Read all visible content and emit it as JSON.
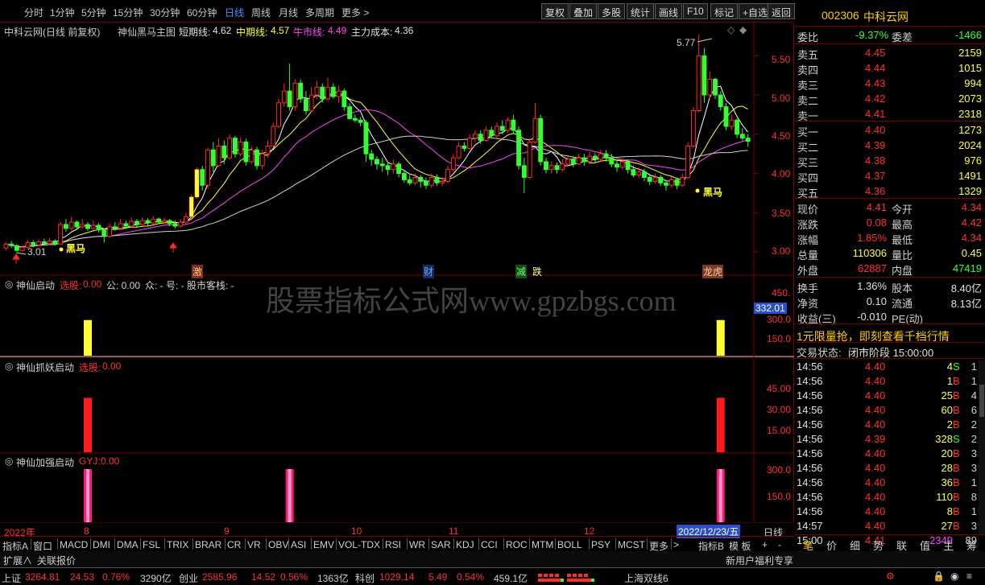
{
  "periods": [
    "分时",
    "1分钟",
    "5分钟",
    "15分钟",
    "30分钟",
    "60分钟",
    "日线",
    "周线",
    "月线",
    "多周期",
    "更多 >"
  ],
  "selected_period": "日线",
  "toolbar_buttons": [
    "复权",
    "叠加",
    "多股",
    "统计",
    "画线",
    "F10",
    "标记",
    "+自选",
    "返回"
  ],
  "header": {
    "stock_title": "中科云网(日线 前复权)",
    "indicator_name": "神仙黑马主图",
    "short_label": "短期线:",
    "short_val": "4.62",
    "mid_label": "中期线:",
    "mid_val": "4.57",
    "bull_label": "牛市线:",
    "bull_val": "4.49",
    "cost_label": "主力成本:",
    "cost_val": "4.36"
  },
  "price_axis": [
    "5.50",
    "5.00",
    "4.50",
    "4.00",
    "3.50",
    "3.00"
  ],
  "annotations": {
    "high": "5.77",
    "low": "3.01",
    "heima": "黑马",
    "heima2": "黑马",
    "ji": "激",
    "cai": "财",
    "jian": "减",
    "die": "跌",
    "longhu": "龙虎"
  },
  "pane1": {
    "name": "神仙启动",
    "xuangu_label": "选股:",
    "xuangu_val": "0.00",
    "gong": "公: 0.00",
    "zhong": "众: -",
    "hao": "号: -",
    "kezhan": "股市客栈: -",
    "axis": [
      "450.",
      "300.0",
      "150.0"
    ],
    "tag": "332.01"
  },
  "pane2": {
    "name": "神仙抓妖启动",
    "xuangu_label": "选股:",
    "xuangu_val": "0.00",
    "axis": [
      "45.00",
      "30.00",
      "15.00"
    ]
  },
  "pane3": {
    "name": "神仙加强启动",
    "gyj_label": "GYJ:",
    "gyj_val": "0.00",
    "axis": [
      "300.0",
      "150.0"
    ]
  },
  "watermark": "股票指标公式网www.gpzbgs.com",
  "date_axis": {
    "year": "2022年",
    "months": [
      "8",
      "9",
      "10",
      "11",
      "12"
    ],
    "cursor_date": "2022/12/23/五",
    "period": "日线"
  },
  "indicator_tabs": [
    "指标A",
    "窗口",
    "MACD",
    "DMI",
    "DMA",
    "FSL",
    "TRIX",
    "BRAR",
    "CR",
    "VR",
    "OBV",
    "ASI",
    "EMV",
    "VOL-TDX",
    "RSI",
    "WR",
    "SAR",
    "KDJ",
    "CCI",
    "ROC",
    "MTM",
    "BOLL",
    "PSY",
    "MCST",
    "更多",
    ">"
  ],
  "indicator_tabs_right": [
    "指标B",
    "模 板",
    "+",
    "-"
  ],
  "quote": {
    "code": "002306",
    "name": "中科云网",
    "weibi_label": "委比",
    "weibi": "-9.37%",
    "weicha_label": "委差",
    "weicha": "-1466",
    "asks": [
      {
        "label": "卖五",
        "price": "4.45",
        "vol": "2159"
      },
      {
        "label": "卖四",
        "price": "4.44",
        "vol": "1015"
      },
      {
        "label": "卖三",
        "price": "4.43",
        "vol": "994"
      },
      {
        "label": "卖二",
        "price": "4.42",
        "vol": "2073"
      },
      {
        "label": "卖一",
        "price": "4.41",
        "vol": "2318"
      }
    ],
    "bids": [
      {
        "label": "买一",
        "price": "4.40",
        "vol": "1273"
      },
      {
        "label": "买二",
        "price": "4.39",
        "vol": "2024"
      },
      {
        "label": "买三",
        "price": "4.38",
        "vol": "976"
      },
      {
        "label": "买四",
        "price": "4.37",
        "vol": "1491"
      },
      {
        "label": "买五",
        "price": "4.36",
        "vol": "1329"
      }
    ],
    "stats": [
      {
        "l1": "现价",
        "v1": "4.41",
        "l2": "今开",
        "v2": "4.34"
      },
      {
        "l1": "涨跌",
        "v1": "0.08",
        "l2": "最高",
        "v2": "4.42"
      },
      {
        "l1": "涨幅",
        "v1": "1.85%",
        "l2": "最低",
        "v2": "4.34"
      },
      {
        "l1": "总量",
        "v1": "110306",
        "l2": "量比",
        "v2": "0.45"
      },
      {
        "l1": "外盘",
        "v1": "62887",
        "l2": "内盘",
        "v2": "47419"
      }
    ],
    "stats2": [
      {
        "l1": "换手",
        "v1": "1.36%",
        "l2": "股本",
        "v2": "8.40亿"
      },
      {
        "l1": "净资",
        "v1": "0.10",
        "l2": "流通",
        "v2": "8.13亿"
      },
      {
        "l1": "收益(三)",
        "v1": "-0.010",
        "l2": "PE(动)",
        "v2": ""
      }
    ],
    "ad": "1元限量抢，即刻查看千档行情",
    "state_label": "交易状态:",
    "state": "闭市阶段 15:00:00",
    "ticks": [
      {
        "t": "14:56",
        "p": "4.40",
        "v": "4",
        "d": "S",
        "n": "1"
      },
      {
        "t": "14:56",
        "p": "4.40",
        "v": "1",
        "d": "B",
        "n": "1"
      },
      {
        "t": "14:56",
        "p": "4.40",
        "v": "25",
        "d": "B",
        "n": "4"
      },
      {
        "t": "14:56",
        "p": "4.40",
        "v": "60",
        "d": "B",
        "n": "6"
      },
      {
        "t": "14:56",
        "p": "4.40",
        "v": "2",
        "d": "B",
        "n": "2"
      },
      {
        "t": "14:56",
        "p": "4.39",
        "v": "328",
        "d": "S",
        "n": "2"
      },
      {
        "t": "14:56",
        "p": "4.40",
        "v": "20",
        "d": "B",
        "n": "3"
      },
      {
        "t": "14:56",
        "p": "4.40",
        "v": "28",
        "d": "B",
        "n": "3"
      },
      {
        "t": "14:56",
        "p": "4.40",
        "v": "36",
        "d": "B",
        "n": "1"
      },
      {
        "t": "14:56",
        "p": "4.40",
        "v": "110",
        "d": "B",
        "n": "8"
      },
      {
        "t": "14:56",
        "p": "4.40",
        "v": "8",
        "d": "B",
        "n": "1"
      },
      {
        "t": "14:57",
        "p": "4.40",
        "v": "27",
        "d": "B",
        "n": "3"
      },
      {
        "t": "15:00",
        "p": "4.41",
        "v": "2349",
        "d": "",
        "n": "89"
      }
    ],
    "bottom_tabs": [
      "笔",
      "价",
      "细",
      "势",
      "联",
      "值",
      "主",
      "筹"
    ]
  },
  "bar2": {
    "expand": "扩展∧",
    "quote": "关联报价",
    "promo": "新用户福利专享"
  },
  "status": {
    "sh_label": "上证",
    "sh_val": "3264.81",
    "sh_chg": "24.53",
    "sh_pct": "0.76%",
    "sh_amt": "3290亿",
    "cy_label": "创业",
    "cy_val": "2585.96",
    "cy_chg": "14.52",
    "cy_pct": "0.56%",
    "cy_amt": "1363亿",
    "kc_label": "科创",
    "kc_val": "1029.14",
    "kc_chg": "5.49",
    "kc_pct": "0.54%",
    "kc_amt": "459.1亿",
    "ticker": "上海双线6"
  },
  "colors": {
    "up": "#ff2a2a",
    "down": "#33ff33",
    "yellow": "#ffff33",
    "magenta": "#ff44ff",
    "blue": "#4a90ff",
    "gold": "#ffcc00"
  },
  "chart_data": {
    "type": "candlestick",
    "period": "日线",
    "ylim": [
      2.95,
      5.8
    ],
    "high_mark": 5.77,
    "low_mark": 3.01,
    "ohlc": [
      [
        3.05,
        3.1,
        3.02,
        3.12
      ],
      [
        3.1,
        3.08,
        3.05,
        3.14
      ],
      [
        3.08,
        3.02,
        3.01,
        3.1
      ],
      [
        3.02,
        3.06,
        3.0,
        3.09
      ],
      [
        3.06,
        3.12,
        3.04,
        3.15
      ],
      [
        3.12,
        3.09,
        3.06,
        3.15
      ],
      [
        3.09,
        3.13,
        3.07,
        3.16
      ],
      [
        3.13,
        3.11,
        3.08,
        3.17
      ],
      [
        3.11,
        3.14,
        3.09,
        3.18
      ],
      [
        3.14,
        3.1,
        3.08,
        3.16
      ],
      [
        3.1,
        3.35,
        3.1,
        3.38
      ],
      [
        3.35,
        3.3,
        3.26,
        3.42
      ],
      [
        3.3,
        3.38,
        3.28,
        3.45
      ],
      [
        3.38,
        3.32,
        3.28,
        3.4
      ],
      [
        3.32,
        3.35,
        3.3,
        3.42
      ],
      [
        3.35,
        3.3,
        3.27,
        3.38
      ],
      [
        3.3,
        3.34,
        3.28,
        3.4
      ],
      [
        3.34,
        3.28,
        3.25,
        3.37
      ],
      [
        3.28,
        3.2,
        3.12,
        3.3
      ],
      [
        3.2,
        3.32,
        3.18,
        3.36
      ],
      [
        3.32,
        3.3,
        3.27,
        3.38
      ],
      [
        3.3,
        3.36,
        3.28,
        3.42
      ],
      [
        3.36,
        3.33,
        3.3,
        3.4
      ],
      [
        3.33,
        3.39,
        3.31,
        3.44
      ],
      [
        3.39,
        3.35,
        3.32,
        3.42
      ],
      [
        3.35,
        3.4,
        3.33,
        3.44
      ],
      [
        3.4,
        3.37,
        3.34,
        3.43
      ],
      [
        3.37,
        3.42,
        3.35,
        3.46
      ],
      [
        3.42,
        3.38,
        3.35,
        3.44
      ],
      [
        3.38,
        3.4,
        3.36,
        3.44
      ],
      [
        3.4,
        3.36,
        3.33,
        3.42
      ],
      [
        3.36,
        3.33,
        3.3,
        3.4
      ],
      [
        3.33,
        3.38,
        3.31,
        3.42
      ],
      [
        3.38,
        3.45,
        3.36,
        3.5
      ],
      [
        3.45,
        3.7,
        3.44,
        3.73
      ],
      [
        3.7,
        4.05,
        3.68,
        4.08
      ],
      [
        4.05,
        3.85,
        3.78,
        4.1
      ],
      [
        3.85,
        4.3,
        3.8,
        4.33
      ],
      [
        4.3,
        4.1,
        4.02,
        4.4
      ],
      [
        4.1,
        4.35,
        4.08,
        4.45
      ],
      [
        4.35,
        4.2,
        4.12,
        4.42
      ],
      [
        4.2,
        4.45,
        4.18,
        4.5
      ],
      [
        4.45,
        4.25,
        4.2,
        4.48
      ],
      [
        4.25,
        4.4,
        4.22,
        4.46
      ],
      [
        4.4,
        4.15,
        4.1,
        4.44
      ],
      [
        4.15,
        4.3,
        4.12,
        4.35
      ],
      [
        4.3,
        4.1,
        4.05,
        4.34
      ],
      [
        4.1,
        4.25,
        4.05,
        4.3
      ],
      [
        4.25,
        4.35,
        4.2,
        4.42
      ],
      [
        4.35,
        4.6,
        4.33,
        4.65
      ],
      [
        4.6,
        4.9,
        4.58,
        4.95
      ],
      [
        4.9,
        5.05,
        4.85,
        5.15
      ],
      [
        5.05,
        4.85,
        4.8,
        5.4
      ],
      [
        4.85,
        5.15,
        4.8,
        5.2
      ],
      [
        5.15,
        4.95,
        4.9,
        5.2
      ],
      [
        4.95,
        4.8,
        4.75,
        5.05
      ],
      [
        4.8,
        5.0,
        4.78,
        5.1
      ],
      [
        5.0,
        5.1,
        4.95,
        5.18
      ],
      [
        5.1,
        4.95,
        4.9,
        5.15
      ],
      [
        4.95,
        5.1,
        4.92,
        5.22
      ],
      [
        5.1,
        4.98,
        4.95,
        5.15
      ],
      [
        4.98,
        5.05,
        4.9,
        5.12
      ],
      [
        5.05,
        4.85,
        4.8,
        5.08
      ],
      [
        4.85,
        4.7,
        4.68,
        4.9
      ],
      [
        4.7,
        4.68,
        4.65,
        4.75
      ],
      [
        4.68,
        4.65,
        4.6,
        4.72
      ],
      [
        4.65,
        4.25,
        4.15,
        4.68
      ],
      [
        4.25,
        4.18,
        4.1,
        4.3
      ],
      [
        4.18,
        4.12,
        4.05,
        4.22
      ],
      [
        4.12,
        4.1,
        4.02,
        4.2
      ],
      [
        4.1,
        4.05,
        3.98,
        4.15
      ],
      [
        4.05,
        4.12,
        4.0,
        4.18
      ],
      [
        4.12,
        4.0,
        3.95,
        4.15
      ],
      [
        4.0,
        3.92,
        3.88,
        4.05
      ],
      [
        3.92,
        3.88,
        3.85,
        3.98
      ],
      [
        3.88,
        3.95,
        3.85,
        4.0
      ],
      [
        3.95,
        3.9,
        3.82,
        3.98
      ],
      [
        3.9,
        3.85,
        3.8,
        3.95
      ],
      [
        3.85,
        3.95,
        3.82,
        4.0
      ],
      [
        3.95,
        3.88,
        3.84,
        3.99
      ],
      [
        3.88,
        3.9,
        3.84,
        3.95
      ],
      [
        3.9,
        4.05,
        3.88,
        4.1
      ],
      [
        4.05,
        4.2,
        4.02,
        4.25
      ],
      [
        4.2,
        4.35,
        4.18,
        4.4
      ],
      [
        4.35,
        4.32,
        4.28,
        4.4
      ],
      [
        4.32,
        4.45,
        4.3,
        4.5
      ],
      [
        4.45,
        4.5,
        4.4,
        4.55
      ],
      [
        4.5,
        4.42,
        4.38,
        4.55
      ],
      [
        4.42,
        4.55,
        4.4,
        4.6
      ],
      [
        4.55,
        4.48,
        4.45,
        4.6
      ],
      [
        4.48,
        4.6,
        4.45,
        4.65
      ],
      [
        4.6,
        4.55,
        4.5,
        4.68
      ],
      [
        4.55,
        4.68,
        4.52,
        4.72
      ],
      [
        4.68,
        4.55,
        4.5,
        4.75
      ],
      [
        4.55,
        4.1,
        4.05,
        4.6
      ],
      [
        4.1,
        3.95,
        3.75,
        4.2
      ],
      [
        3.95,
        4.4,
        3.93,
        4.45
      ],
      [
        4.4,
        4.7,
        4.38,
        4.9
      ],
      [
        4.7,
        4.15,
        4.1,
        4.75
      ],
      [
        4.15,
        4.05,
        4.0,
        4.2
      ],
      [
        4.05,
        4.1,
        4.0,
        4.15
      ],
      [
        4.1,
        4.05,
        4.0,
        4.14
      ],
      [
        4.05,
        4.12,
        4.02,
        4.18
      ],
      [
        4.12,
        4.18,
        4.08,
        4.22
      ],
      [
        4.18,
        4.12,
        4.08,
        4.22
      ],
      [
        4.12,
        4.2,
        4.1,
        4.25
      ],
      [
        4.2,
        4.15,
        4.1,
        4.25
      ],
      [
        4.15,
        4.22,
        4.12,
        4.28
      ],
      [
        4.22,
        4.18,
        4.14,
        4.26
      ],
      [
        4.18,
        4.25,
        4.15,
        4.3
      ],
      [
        4.25,
        4.2,
        4.15,
        4.3
      ],
      [
        4.2,
        4.12,
        4.08,
        4.25
      ],
      [
        4.12,
        4.08,
        4.02,
        4.18
      ],
      [
        4.08,
        4.15,
        4.05,
        4.2
      ],
      [
        4.15,
        4.05,
        4.0,
        4.18
      ],
      [
        4.05,
        3.98,
        3.95,
        4.1
      ],
      [
        3.98,
        4.02,
        3.94,
        4.08
      ],
      [
        4.02,
        3.95,
        3.9,
        4.06
      ],
      [
        3.95,
        3.9,
        3.85,
        4.0
      ],
      [
        3.9,
        3.95,
        3.87,
        4.0
      ],
      [
        3.95,
        3.88,
        3.84,
        3.98
      ],
      [
        3.88,
        3.85,
        3.78,
        3.92
      ],
      [
        3.85,
        3.92,
        3.82,
        3.96
      ],
      [
        3.92,
        3.85,
        3.8,
        3.95
      ],
      [
        3.85,
        3.95,
        3.83,
        4.0
      ],
      [
        3.95,
        4.35,
        3.93,
        4.4
      ],
      [
        4.35,
        4.8,
        4.33,
        4.85
      ],
      [
        4.8,
        5.5,
        4.78,
        5.77
      ],
      [
        5.5,
        5.0,
        4.9,
        5.6
      ],
      [
        5.0,
        5.2,
        4.95,
        5.3
      ],
      [
        5.2,
        5.0,
        4.95,
        5.22
      ],
      [
        5.0,
        4.85,
        4.8,
        5.05
      ],
      [
        4.85,
        4.6,
        4.55,
        4.9
      ],
      [
        4.6,
        4.68,
        4.55,
        4.75
      ],
      [
        4.68,
        4.5,
        4.45,
        4.7
      ],
      [
        4.5,
        4.45,
        4.42,
        4.58
      ],
      [
        4.45,
        4.41,
        4.34,
        4.5
      ]
    ],
    "ma": [
      {
        "name": "短期线",
        "value": 4.62
      },
      {
        "name": "中期线",
        "value": 4.57
      },
      {
        "name": "牛市线",
        "value": 4.49
      },
      {
        "name": "主力成本",
        "value": 4.36
      }
    ],
    "pane1_bars": [
      {
        "index": 15,
        "value": 332.01
      },
      {
        "index": 131,
        "value": 332.01
      }
    ],
    "pane2_bars": [
      {
        "index": 15,
        "value": 40
      },
      {
        "index": 131,
        "value": 40
      }
    ],
    "pane3_bars": [
      {
        "index": 15,
        "value": 300
      },
      {
        "index": 52,
        "value": 300
      },
      {
        "index": 131,
        "value": 300
      }
    ]
  }
}
